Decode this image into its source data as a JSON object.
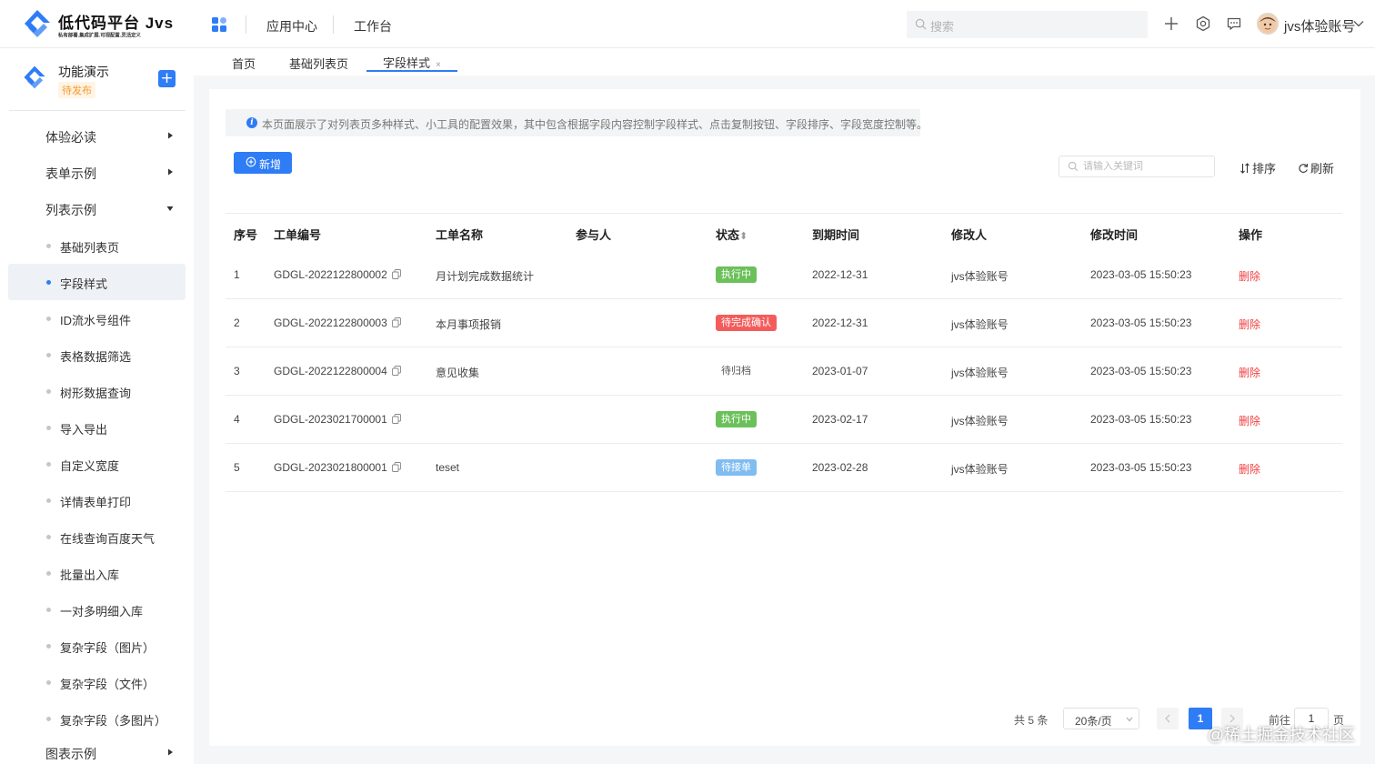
{
  "header": {
    "brand_title": "低代码平台 Jvs",
    "brand_subtitle": "私有部署.集成扩展.可视配置.灵活定义",
    "nav": [
      "应用中心",
      "工作台"
    ],
    "search_placeholder": "搜索",
    "user_name": "jvs体验账号"
  },
  "sidebar": {
    "app_name": "功能演示",
    "app_status": "待发布",
    "add_symbol": "+",
    "groups": [
      {
        "label": "体验必读",
        "expanded": false
      },
      {
        "label": "表单示例",
        "expanded": false
      },
      {
        "label": "列表示例",
        "expanded": true
      }
    ],
    "items": [
      "基础列表页",
      "字段样式",
      "ID流水号组件",
      "表格数据筛选",
      "树形数据查询",
      "导入导出",
      "自定义宽度",
      "详情表单打印",
      "在线查询百度天气",
      "批量出入库",
      "一对多明细入库",
      "复杂字段（图片）",
      "复杂字段（文件）",
      "复杂字段（多图片）"
    ],
    "active_item": "字段样式",
    "last_group": "图表示例"
  },
  "tabs": {
    "items": [
      "首页",
      "基础列表页",
      "字段样式"
    ],
    "active": "字段样式",
    "close_symbol": "×"
  },
  "toolbar": {
    "notice": "本页面展示了对列表页多种样式、小工具的配置效果，其中包含根据字段内容控制字段样式、点击复制按钮、字段排序、字段宽度控制等。",
    "new_label": "新增",
    "keyword_placeholder": "请输入关键词",
    "sort_label": "排序",
    "refresh_label": "刷新"
  },
  "table": {
    "columns": [
      "序号",
      "工单编号",
      "工单名称",
      "参与人",
      "状态",
      "到期时间",
      "修改人",
      "修改时间",
      "操作"
    ],
    "sort_indicator": "⬍",
    "rows": [
      {
        "no": "1",
        "code": "GDGL-2022122800002",
        "name": "月计划完成数据统计",
        "participant": "",
        "status": "执行中",
        "status_color": "green",
        "due": "2022-12-31",
        "modifier": "jvs体验账号",
        "modified": "2023-03-05 15:50:23",
        "action": "删除"
      },
      {
        "no": "2",
        "code": "GDGL-2022122800003",
        "name": "本月事项报销",
        "participant": "",
        "status": "待完成确认",
        "status_color": "red",
        "due": "2022-12-31",
        "modifier": "jvs体验账号",
        "modified": "2023-03-05 15:50:23",
        "action": "删除"
      },
      {
        "no": "3",
        "code": "GDGL-2022122800004",
        "name": "意见收集",
        "participant": "",
        "status": "待归档",
        "status_color": "plain",
        "due": "2023-01-07",
        "modifier": "jvs体验账号",
        "modified": "2023-03-05 15:50:23",
        "action": "删除"
      },
      {
        "no": "4",
        "code": "GDGL-2023021700001",
        "name": "",
        "participant": "",
        "status": "执行中",
        "status_color": "green",
        "due": "2023-02-17",
        "modifier": "jvs体验账号",
        "modified": "2023-03-05 15:50:23",
        "action": "删除"
      },
      {
        "no": "5",
        "code": "GDGL-2023021800001",
        "name": "teset",
        "participant": "",
        "status": "待接单",
        "status_color": "blue",
        "due": "2023-02-28",
        "modifier": "jvs体验账号",
        "modified": "2023-03-05 15:50:23",
        "action": "删除"
      }
    ]
  },
  "pagination": {
    "total": "共 5 条",
    "page_size": "20条/页",
    "current_page": "1",
    "goto_label": "前往",
    "goto_value": "1",
    "page_suffix": "页"
  },
  "watermark": "@稀土掘金技术社区",
  "colors": {
    "primary": "#2e7cf6",
    "danger": "#f03f3f",
    "success": "#6cc05a",
    "warning": "#f39b2d"
  }
}
